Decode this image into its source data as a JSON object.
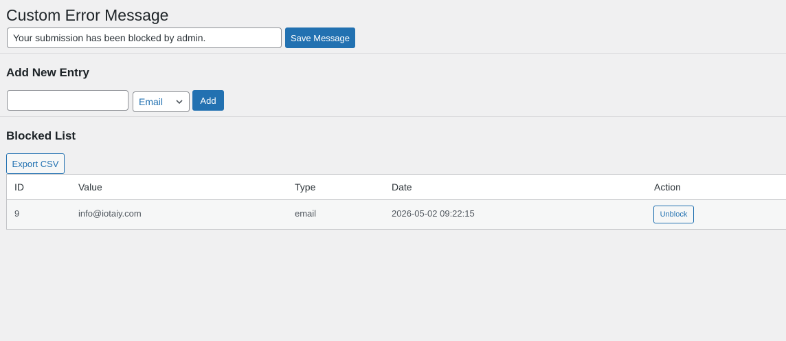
{
  "custom_error": {
    "title": "Custom Error Message",
    "message_value": "Your submission has been blocked by admin.",
    "save_label": "Save Message"
  },
  "add_entry": {
    "title": "Add New Entry",
    "input_value": "",
    "type_selected": "Email",
    "add_label": "Add"
  },
  "blocked_list": {
    "title": "Blocked List",
    "export_label": "Export CSV",
    "columns": [
      "ID",
      "Value",
      "Type",
      "Date",
      "Action"
    ],
    "rows": [
      {
        "id": "9",
        "value": "info@iotaiy.com",
        "type": "email",
        "date": "2026-05-02 09:22:15",
        "action_label": "Unblock"
      }
    ]
  },
  "colors": {
    "accent": "#2271b1",
    "background": "#f0f0f1"
  }
}
